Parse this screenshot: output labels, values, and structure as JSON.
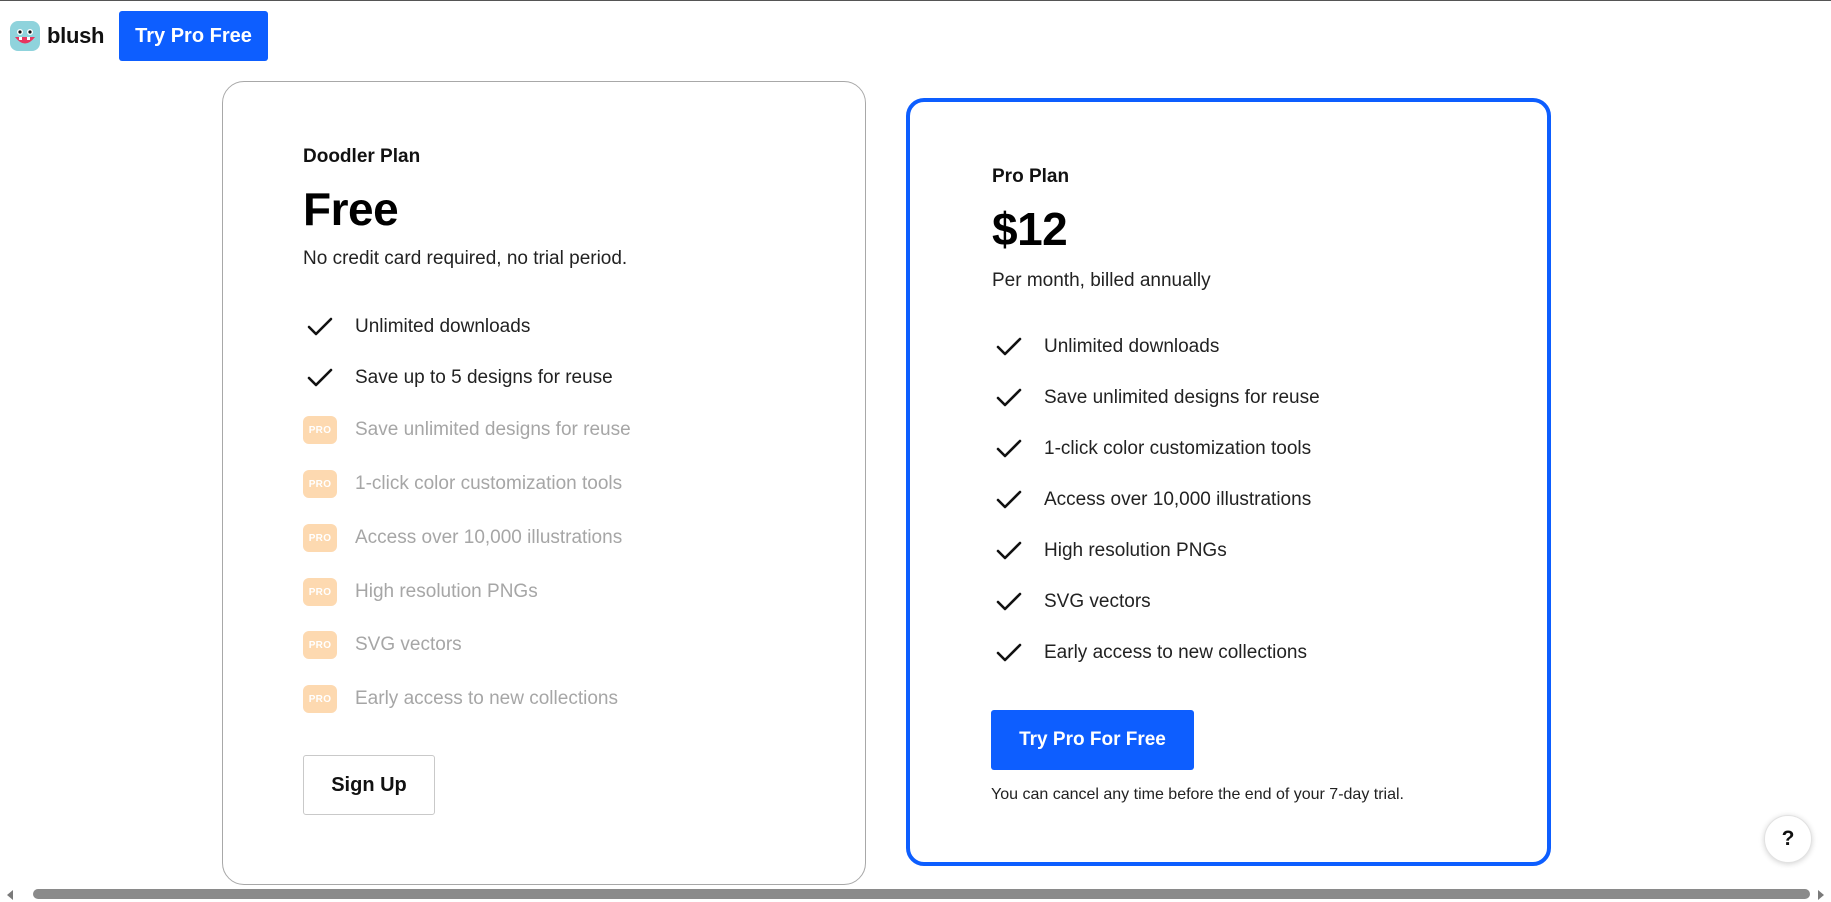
{
  "header": {
    "brand_name": "blush",
    "logo_icon": "blush-monster-logo-icon",
    "cta_label": "Try Pro Free"
  },
  "colors": {
    "accent": "#0d5eff",
    "pro_badge": "#fdd9b0",
    "muted_text": "#a6a6a6",
    "card_border": "#a8a8a8"
  },
  "plans": {
    "free": {
      "name": "Doodler Plan",
      "price": "Free",
      "subtitle": "No credit card required, no trial period.",
      "features": [
        {
          "label": "Unlimited downloads",
          "included": true,
          "icon": "check-icon"
        },
        {
          "label": "Save up to 5 designs for reuse",
          "included": true,
          "icon": "check-icon"
        },
        {
          "label": "Save unlimited designs for reuse",
          "included": false,
          "icon": "pro-badge-icon",
          "badge": "PRO"
        },
        {
          "label": "1-click color customization tools",
          "included": false,
          "icon": "pro-badge-icon",
          "badge": "PRO"
        },
        {
          "label": "Access over 10,000 illustrations",
          "included": false,
          "icon": "pro-badge-icon",
          "badge": "PRO"
        },
        {
          "label": "High resolution PNGs",
          "included": false,
          "icon": "pro-badge-icon",
          "badge": "PRO"
        },
        {
          "label": "SVG vectors",
          "included": false,
          "icon": "pro-badge-icon",
          "badge": "PRO"
        },
        {
          "label": "Early access to new collections",
          "included": false,
          "icon": "pro-badge-icon",
          "badge": "PRO"
        }
      ],
      "button_label": "Sign Up"
    },
    "pro": {
      "name": "Pro Plan",
      "price": "$12",
      "subtitle": "Per month, billed annually",
      "features": [
        {
          "label": "Unlimited downloads",
          "included": true,
          "icon": "check-icon"
        },
        {
          "label": "Save unlimited designs for reuse",
          "included": true,
          "icon": "check-icon"
        },
        {
          "label": "1-click color customization tools",
          "included": true,
          "icon": "check-icon"
        },
        {
          "label": "Access over 10,000 illustrations",
          "included": true,
          "icon": "check-icon"
        },
        {
          "label": "High resolution PNGs",
          "included": true,
          "icon": "check-icon"
        },
        {
          "label": "SVG vectors",
          "included": true,
          "icon": "check-icon"
        },
        {
          "label": "Early access to new collections",
          "included": true,
          "icon": "check-icon"
        }
      ],
      "button_label": "Try Pro For Free",
      "note": "You can cancel any time before the end of your 7-day trial."
    }
  },
  "help_button_label": "?"
}
